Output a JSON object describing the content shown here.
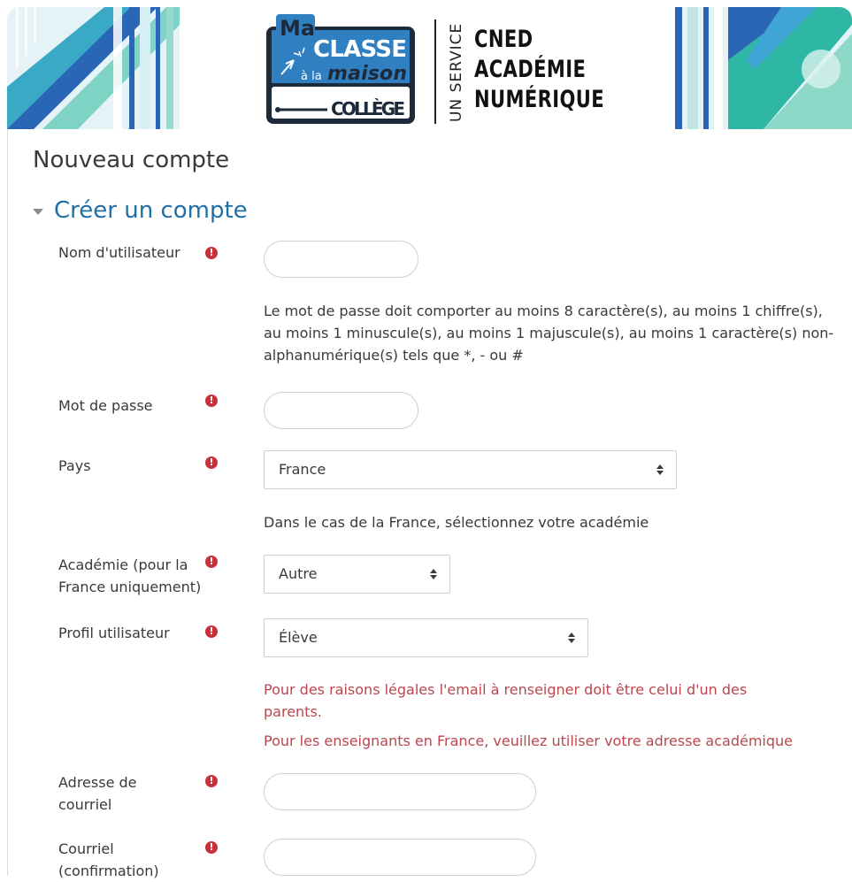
{
  "banner": {
    "logo_ma": "Ma",
    "logo_classe": "CLASSE",
    "logo_ala": "à la",
    "logo_maison": "maison",
    "logo_college": "COLLÈGE",
    "service": "UN SERVICE",
    "cned_lines": [
      "CNED",
      "ACADÉMIE",
      "NUMÉRIQUE"
    ],
    "colors": {
      "blue": "#2f7fc1",
      "dark": "#1c2a3a",
      "teal": "#2fb7a6"
    }
  },
  "page": {
    "title": "Nouveau compte"
  },
  "section": {
    "title": "Créer un compte"
  },
  "form": {
    "username": {
      "label": "Nom d'utilisateur",
      "value": ""
    },
    "password_help": "Le mot de passe doit comporter au moins 8 caractère(s), au moins 1 chiffre(s), au moins 1 minuscule(s), au moins 1 majuscule(s), au moins 1 caractère(s) non-alphanumérique(s) tels que *, - ou #",
    "password": {
      "label": "Mot de passe",
      "value": ""
    },
    "country": {
      "label": "Pays",
      "value": "France"
    },
    "country_help": "Dans le cas de la France, sélectionnez votre académie",
    "academy": {
      "label": "Académie (pour la France uniquement)",
      "value": "Autre"
    },
    "profile": {
      "label": "Profil utilisateur",
      "value": "Élève"
    },
    "profile_warning_1": "Pour des raisons légales l'email à renseigner doit être celui d'un des parents.",
    "profile_warning_2": "Pour les enseignants en France, veuillez utiliser votre adresse académique",
    "email": {
      "label": "Adresse de courriel",
      "value": ""
    },
    "email_confirm": {
      "label": "Courriel (confirmation)",
      "value": ""
    },
    "required_icon": "exclamation-circle-icon",
    "required_color": "#c8303c",
    "warning_color": "#b9474e",
    "accent_color": "#1f6fa8"
  }
}
